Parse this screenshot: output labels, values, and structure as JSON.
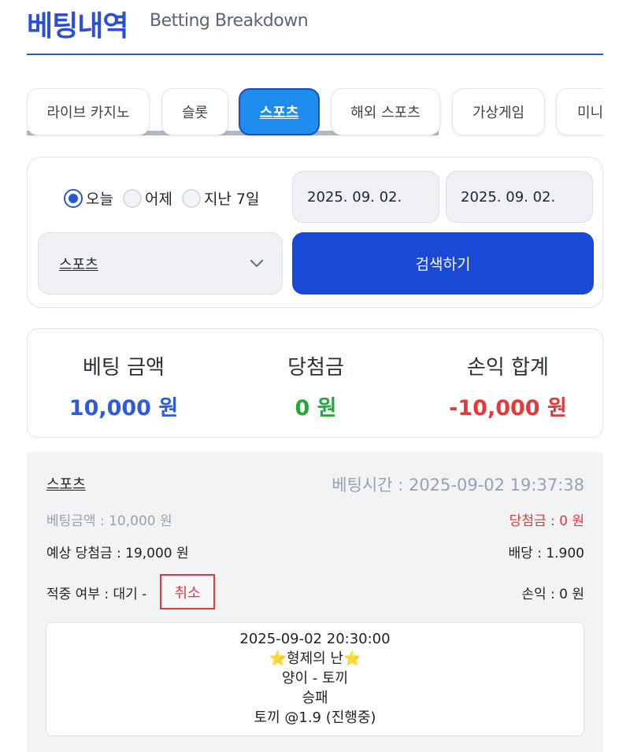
{
  "header": {
    "title": "베팅내역",
    "subtitle": "Betting Breakdown"
  },
  "tabs": [
    {
      "label": "라이브 카지노",
      "active": false
    },
    {
      "label": "슬롯",
      "active": false
    },
    {
      "label": "스포츠",
      "active": true
    },
    {
      "label": "해외 스포츠",
      "active": false
    },
    {
      "label": "가상게임",
      "active": false
    },
    {
      "label": "미니",
      "active": false
    }
  ],
  "filter": {
    "radios": [
      {
        "label": "오늘",
        "checked": true
      },
      {
        "label": "어제",
        "checked": false
      },
      {
        "label": "지난 7일",
        "checked": false
      }
    ],
    "date_from": "2025. 09. 02.",
    "date_to": "2025. 09. 02.",
    "game_select": "스포츠",
    "search_label": "검색하기"
  },
  "summary": {
    "bet_label": "베팅 금액",
    "bet_value": "10,000 원",
    "win_label": "당첨금",
    "win_value": "0 원",
    "profit_label": "손익 합계",
    "profit_value": "-10,000 원"
  },
  "bet": {
    "game": "스포츠",
    "bet_time": "베팅시간 : 2025-09-02 19:37:38",
    "bet_amount": "베팅금액 : 10,000 원",
    "win_amount": "당첨금 : 0 원",
    "expected_win": "예상 당첨금 : 19,000 원",
    "odds": "배당 : 1.900",
    "hit_status": "적중 여부 : 대기 -",
    "cancel_label": "취소",
    "profit": "손익 : 0 원",
    "detail": {
      "match_time": "2025-09-02 20:30:00",
      "event": "⭐형제의 난⭐",
      "teams": "양이 - 토끼",
      "market": "승패",
      "pick": "토끼 @1.9 (진행중)"
    }
  },
  "colors": {
    "accent": "#2b4fd6",
    "blue_value": "#2e5bd8",
    "green_value": "#22a83d",
    "red_value": "#e23a3a"
  }
}
